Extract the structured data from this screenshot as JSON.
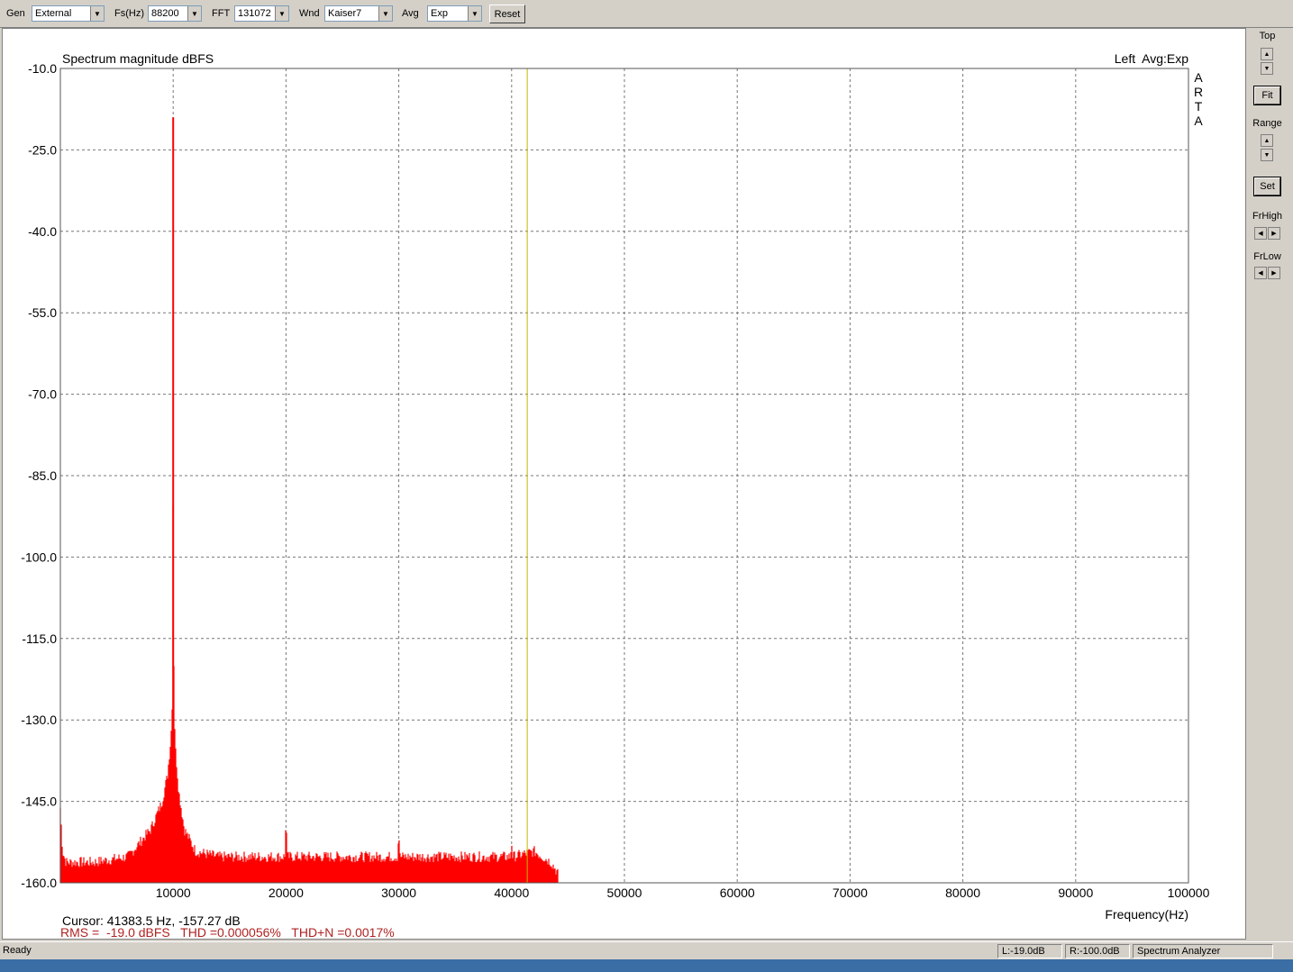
{
  "toolbar": {
    "gen_label": "Gen",
    "gen_value": "External",
    "fs_label": "Fs(Hz)",
    "fs_value": "88200",
    "fft_label": "FFT",
    "fft_value": "131072",
    "wnd_label": "Wnd",
    "wnd_value": "Kaiser7",
    "avg_label": "Avg",
    "avg_value": "Exp",
    "reset_label": "Reset"
  },
  "plot": {
    "title": "Spectrum magnitude dBFS",
    "channel_info": "Left  Avg:Exp",
    "brand_letters": [
      "A",
      "R",
      "T",
      "A"
    ],
    "cursor_text": "Cursor: 41383.5 Hz, -157.27 dB",
    "measurement_text": "RMS =  -19.0 dBFS   THD =0.000056%   THD+N =0.0017%",
    "xlabel": "Frequency(Hz)",
    "trace_color": "#ff0000",
    "cursor_color": "#c8b400",
    "measurement_color": "#b22222"
  },
  "right_panel": {
    "top_label": "Top",
    "fit_label": "Fit",
    "range_label": "Range",
    "set_label": "Set",
    "frhigh_label": "FrHigh",
    "frlow_label": "FrLow"
  },
  "status": {
    "ready": "Ready",
    "left_level": "L:-19.0dB",
    "right_level": "R:-100.0dB",
    "mode": "Spectrum Analyzer"
  },
  "chart_data": {
    "type": "line",
    "xlim": [
      0,
      100000
    ],
    "ylim": [
      -160,
      -10
    ],
    "x_ticks": [
      10000,
      20000,
      30000,
      40000,
      50000,
      60000,
      70000,
      80000,
      90000,
      100000
    ],
    "y_ticks": [
      -10.0,
      -25.0,
      -40.0,
      -55.0,
      -70.0,
      -85.0,
      -100.0,
      -115.0,
      -130.0,
      -145.0,
      -160.0
    ],
    "x_tick_labels": [
      "10000",
      "20000",
      "30000",
      "40000",
      "50000",
      "60000",
      "70000",
      "80000",
      "90000",
      "100000"
    ],
    "y_tick_labels": [
      "-10.0",
      "-25.0",
      "-40.0",
      "-55.0",
      "-70.0",
      "-85.0",
      "-100.0",
      "-115.0",
      "-130.0",
      "-145.0",
      "-160.0"
    ],
    "grid": true,
    "cursor_x": 41383.5,
    "noise_floor": [
      -157,
      -154
    ],
    "series": [
      {
        "x": [
          0,
          200,
          500,
          1000,
          3000,
          6000,
          8000,
          9000,
          9500,
          9800,
          9900,
          9950,
          9980,
          10000,
          10020,
          10050,
          10100,
          10200,
          10500,
          11000,
          12000,
          14000,
          16000,
          19900,
          20000,
          20100,
          25000,
          29900,
          30000,
          30100,
          35000,
          38000,
          39900,
          40000,
          40100,
          42000,
          43500,
          44100
        ],
        "y": [
          -146,
          -154,
          -156,
          -156,
          -156,
          -155,
          -150,
          -145,
          -140,
          -133,
          -128,
          -116,
          -108,
          -19,
          -108,
          -116,
          -128,
          -135,
          -143,
          -150,
          -154,
          -155,
          -155,
          -155,
          -147,
          -155,
          -155,
          -155,
          -150,
          -155,
          -155,
          -155,
          -155,
          -152,
          -155,
          -154,
          -156,
          -158
        ]
      }
    ]
  }
}
